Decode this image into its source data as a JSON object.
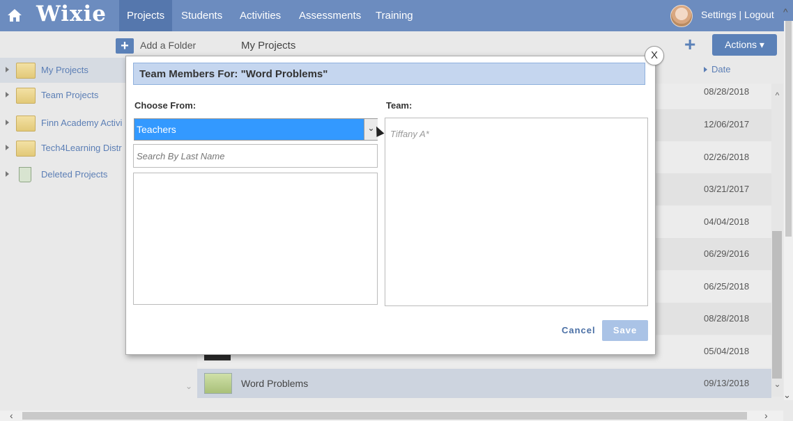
{
  "app": {
    "logo": "Wixie"
  },
  "nav": {
    "items": [
      {
        "label": "Projects",
        "active": true
      },
      {
        "label": "Students",
        "active": false
      },
      {
        "label": "Activities",
        "active": false
      },
      {
        "label": "Assessments",
        "active": false
      },
      {
        "label": "Training",
        "active": false
      }
    ],
    "settings_logout": "Settings | Logout"
  },
  "toolbar": {
    "add_folder_label": "Add a Folder",
    "title": "My Projects",
    "actions_label": "Actions ▾"
  },
  "sidebar": {
    "items": [
      {
        "label": "My Projects",
        "icon": "folder-icon",
        "selected": true
      },
      {
        "label": "Team Projects",
        "icon": "folder-icon",
        "selected": false
      },
      {
        "label": "Finn Academy Activi",
        "icon": "folder-icon",
        "selected": false
      },
      {
        "label": "Tech4Learning Distr",
        "icon": "folder-icon",
        "selected": false
      },
      {
        "label": "Deleted Projects",
        "icon": "trash-icon",
        "selected": false
      }
    ]
  },
  "list": {
    "date_header": "Date",
    "rows": [
      {
        "name": "",
        "date": "08/28/2018"
      },
      {
        "name": "",
        "date": "12/06/2017"
      },
      {
        "name": "",
        "date": "02/26/2018"
      },
      {
        "name": "",
        "date": "03/21/2017"
      },
      {
        "name": "",
        "date": "04/04/2018"
      },
      {
        "name": "",
        "date": "06/29/2016"
      },
      {
        "name": "",
        "date": "06/25/2018"
      },
      {
        "name": "",
        "date": "08/28/2018"
      },
      {
        "name": "",
        "date": "05/04/2018"
      },
      {
        "name": "Word Problems",
        "date": "09/13/2018",
        "selected": true
      }
    ]
  },
  "modal": {
    "close_label": "X",
    "title": "Team Members For: \"Word Problems\"",
    "choose_from_label": "Choose From:",
    "choose_from_value": "Teachers",
    "search_placeholder": "Search By Last Name",
    "team_label": "Team:",
    "team_members": [
      "Tiffany A*"
    ],
    "cancel_label": "Cancel",
    "save_label": "Save"
  },
  "colors": {
    "nav_bg": "#6c8cbf",
    "nav_active": "#5577ad",
    "accent": "#5b81b8",
    "modal_header": "#c5d6ef",
    "select_highlight": "#3399ff",
    "save_disabled": "#aac3e6"
  }
}
